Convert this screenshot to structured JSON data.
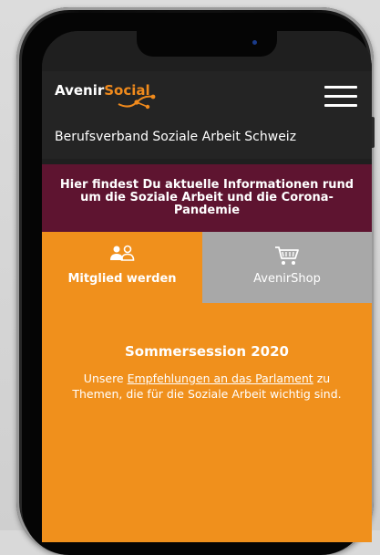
{
  "header": {
    "logo_prefix": "Avenir",
    "logo_accent": "Social",
    "menu_icon": "hamburger-menu-icon"
  },
  "subtitle": "Berufsverband Soziale Arbeit Schweiz",
  "banner": {
    "text": "Hier findest Du aktuelle Informationen rund um die Soziale Arbeit und die Corona-Pandemie"
  },
  "tiles": [
    {
      "label": "Mitglied werden",
      "icon": "members-icon"
    },
    {
      "label": "AvenirShop",
      "icon": "shopping-cart-icon"
    }
  ],
  "main": {
    "headline": "Sommersession 2020",
    "body_before": "Unsere ",
    "body_link": "Empfehlungen an das Parlament",
    "body_after": " zu Themen, die für die Soziale Arbeit wichtig sind."
  },
  "colors": {
    "brand_orange": "#f0901c",
    "banner_maroon": "#5e1430",
    "dark_bar": "#242424",
    "shop_gray": "#a8a8a8"
  }
}
